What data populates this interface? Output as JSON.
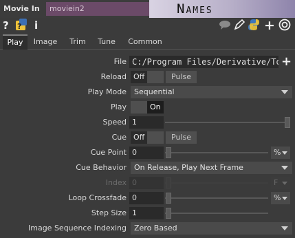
{
  "header": {
    "op_type": "Movie In",
    "op_name": "moviein2",
    "banner_text": "Names"
  },
  "icons": [
    "help-icon",
    "python-help-icon",
    "info-icon",
    "comment-icon",
    "edit-icon",
    "python-icon",
    "add-icon",
    "target-icon"
  ],
  "icon_glyphs": {
    "help": "?",
    "info": "i",
    "add": "+"
  },
  "tabs": [
    {
      "label": "Play",
      "active": true
    },
    {
      "label": "Image"
    },
    {
      "label": "Trim"
    },
    {
      "label": "Tune"
    },
    {
      "label": "Common"
    }
  ],
  "params": {
    "file": {
      "label": "File",
      "value": "C:/Program Files/Derivative/To"
    },
    "reload": {
      "label": "Reload",
      "toggle": "Off",
      "pulse": "Pulse"
    },
    "play_mode": {
      "label": "Play Mode",
      "value": "Sequential"
    },
    "play": {
      "label": "Play",
      "toggle": "On"
    },
    "speed": {
      "label": "Speed",
      "value": "1",
      "level": 1.0
    },
    "cue": {
      "label": "Cue",
      "toggle": "Off",
      "pulse": "Pulse"
    },
    "cue_point": {
      "label": "Cue Point",
      "value": "0",
      "unit": "%"
    },
    "cue_behavior": {
      "label": "Cue Behavior",
      "value": "On Release, Play Next Frame"
    },
    "index": {
      "label": "Index",
      "value": "0",
      "unit": "F"
    },
    "loop_crossfade": {
      "label": "Loop Crossfade",
      "value": "0",
      "unit": "%"
    },
    "step_size": {
      "label": "Step Size",
      "value": "1"
    },
    "image_seq": {
      "label": "Image Sequence Indexing",
      "value": "Zero Based"
    }
  },
  "colors": {
    "name_field": "#6b4a68",
    "background": "#3b3b3b"
  }
}
